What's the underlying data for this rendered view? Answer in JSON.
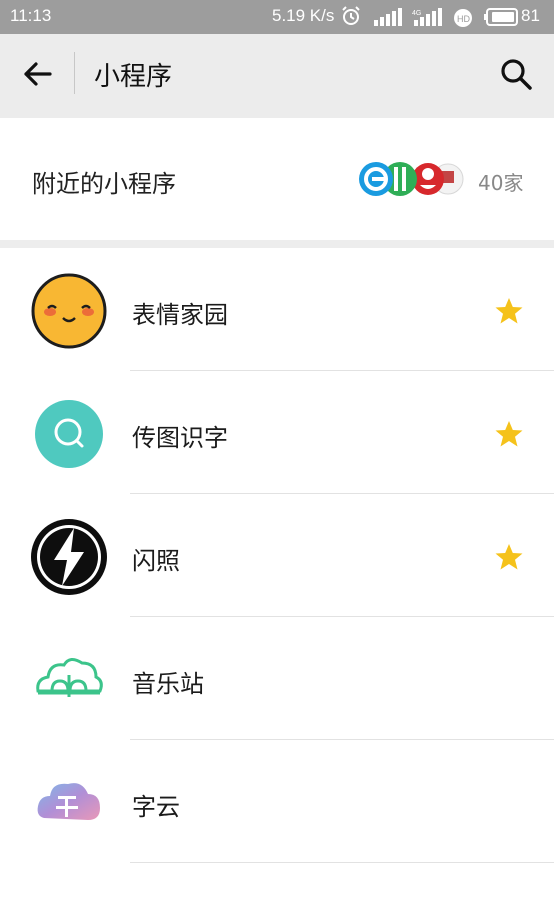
{
  "status_bar": {
    "time": "11:13",
    "net_speed": "5.19 K/s",
    "battery": "81",
    "icons": [
      "alarm-icon",
      "signal-icon",
      "signal-4g-icon",
      "hd-icon",
      "battery-icon"
    ]
  },
  "header": {
    "title": "小程序",
    "back_icon": "arrow-left-icon",
    "search_icon": "search-icon"
  },
  "nearby": {
    "label": "附近的小程序",
    "count": "40家"
  },
  "apps": [
    {
      "name": "表情家园",
      "starred": true,
      "icon": "smiley-face-icon"
    },
    {
      "name": "传图识字",
      "starred": true,
      "icon": "magnifier-circle-icon"
    },
    {
      "name": "闪照",
      "starred": true,
      "icon": "lightning-bolt-icon"
    },
    {
      "name": "音乐站",
      "starred": false,
      "icon": "music-cloud-icon"
    },
    {
      "name": "字云",
      "starred": false,
      "icon": "word-cloud-icon"
    }
  ],
  "colors": {
    "status_bar": "#9d9d9d",
    "nav_bar": "#ececec",
    "star": "#f5c21b",
    "teal": "#4fc9bf",
    "green_outline": "#3cc48b",
    "smiley": "#f8b733"
  }
}
